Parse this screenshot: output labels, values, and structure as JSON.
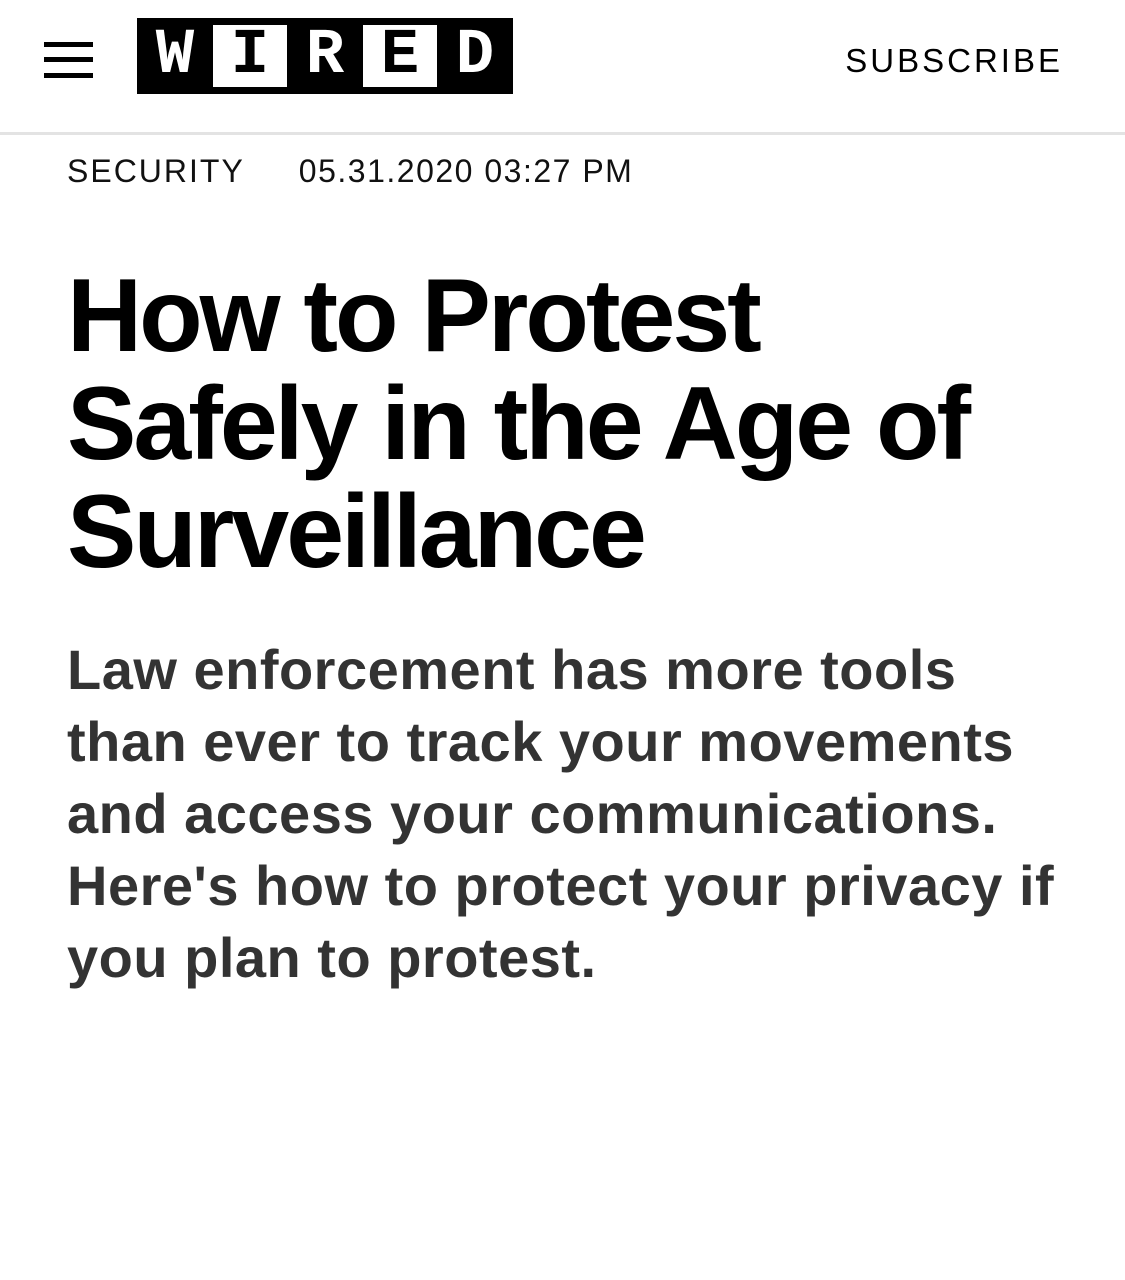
{
  "header": {
    "menu_icon": "hamburger-menu-icon",
    "logo": [
      "W",
      "I",
      "R",
      "E",
      "D"
    ],
    "subscribe_label": "SUBSCRIBE"
  },
  "article": {
    "category": "SECURITY",
    "timestamp": "05.31.2020 03:27 PM",
    "title": "How to Protest Safely in the Age of Surveillance",
    "dek": "Law enforcement has more tools than ever to track your movements and access your communications. Here's how to protect your privacy if you plan to protest."
  },
  "colors": {
    "text": "#000000",
    "dek_text": "#333333",
    "divider": "#e3e3e3",
    "background": "#ffffff"
  }
}
